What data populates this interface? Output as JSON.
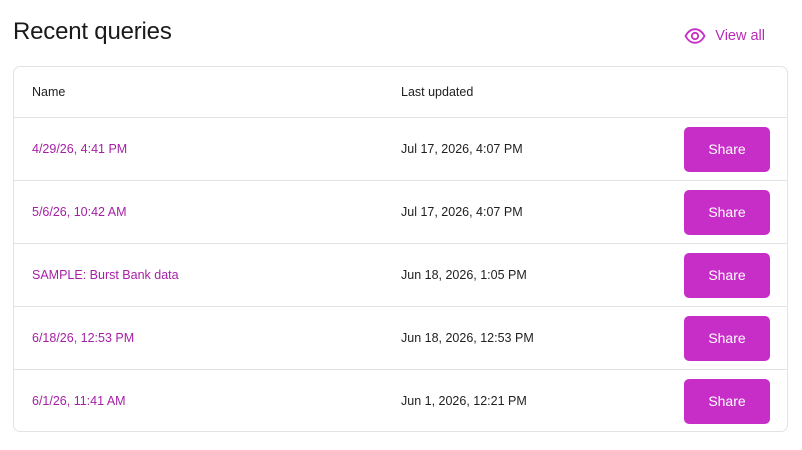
{
  "header": {
    "title": "Recent queries",
    "view_all_label": "View all",
    "view_all_icon": "eye-icon"
  },
  "colors": {
    "accent": "#c72ec7",
    "link": "#a61fa6",
    "border": "#e3e3e6"
  },
  "table": {
    "columns": {
      "name": "Name",
      "last_updated": "Last updated"
    },
    "rows": [
      {
        "name": "4/29/26, 4:41 PM",
        "last_updated": "Jul 17, 2026, 4:07 PM",
        "action": "Share"
      },
      {
        "name": "5/6/26, 10:42 AM",
        "last_updated": "Jul 17, 2026, 4:07 PM",
        "action": "Share"
      },
      {
        "name": "SAMPLE: Burst Bank data",
        "last_updated": "Jun 18, 2026, 1:05 PM",
        "action": "Share"
      },
      {
        "name": "6/18/26, 12:53 PM",
        "last_updated": "Jun 18, 2026, 12:53 PM",
        "action": "Share"
      },
      {
        "name": "6/1/26, 11:41 AM",
        "last_updated": "Jun 1, 2026, 12:21 PM",
        "action": "Share"
      }
    ]
  }
}
